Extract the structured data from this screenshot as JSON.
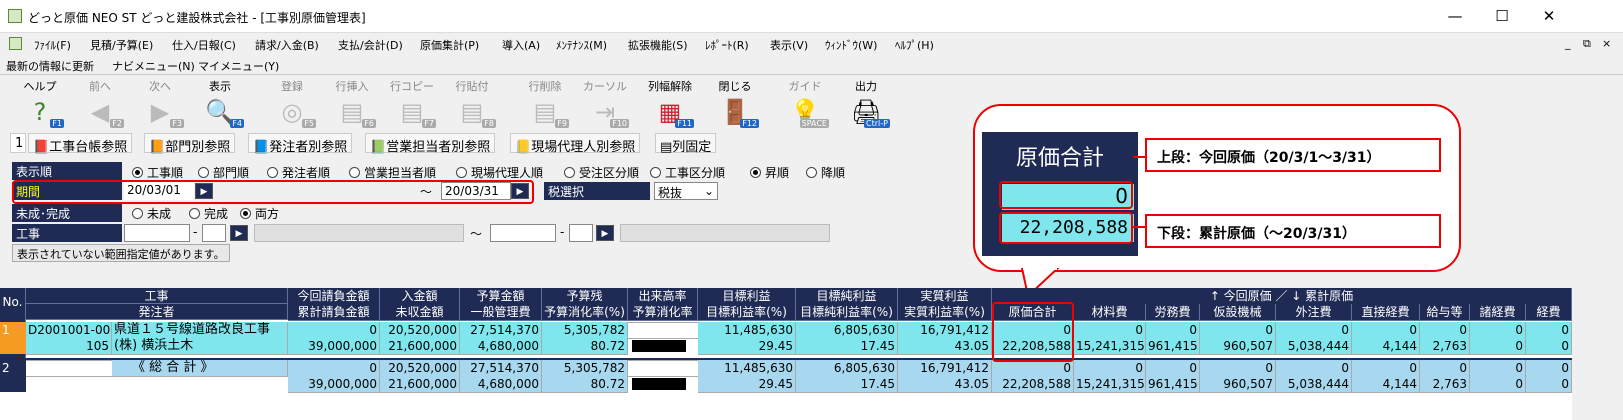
{
  "window": {
    "title": "どっと原価 NEO ST どっと建設株式会社 - [工事別原価管理表]",
    "minimize": "—",
    "maximize": "☐",
    "close": "✕"
  },
  "menu": [
    "ﾌｧｲﾙ(F)",
    "見積/予算(E)",
    "仕入/日報(C)",
    "請求/入金(B)",
    "支払/会計(D)",
    "原価集計(P)",
    "導入(A)",
    "ﾒﾝﾃﾅﾝｽ(M)",
    "拡張機能(S)",
    "ﾚﾎﾟｰﾄ(R)",
    "表示(V)",
    "ｳｨﾝﾄﾞｳ(W)",
    "ﾍﾙﾌﾟ(H)"
  ],
  "menu_right": [
    "_",
    "⧉",
    "×"
  ],
  "links": [
    "最新の情報に更新",
    "ナビメニュー(N)",
    "マイメニュー(Y)"
  ],
  "toolbar": [
    {
      "label": "ヘルプ",
      "key": "F1",
      "icon": "?"
    },
    {
      "label": "前へ",
      "key": "F2",
      "icon": "◀"
    },
    {
      "label": "次へ",
      "key": "F3",
      "icon": "▶"
    },
    {
      "label": "表示",
      "key": "F4",
      "icon": "🔍"
    },
    {
      "label": "登録",
      "key": "F5",
      "icon": "◎"
    },
    {
      "label": "行挿入",
      "key": "F6",
      "icon": "▤"
    },
    {
      "label": "行コピー",
      "key": "F7",
      "icon": "▤"
    },
    {
      "label": "行貼付",
      "key": "F8",
      "icon": "▤"
    },
    {
      "label": "行削除",
      "key": "F9",
      "icon": "▤"
    },
    {
      "label": "カーソル",
      "key": "F10",
      "icon": "⇥"
    },
    {
      "label": "列幅解除",
      "key": "F11",
      "icon": "▦"
    },
    {
      "label": "閉じる",
      "key": "F12",
      "icon": "🚪"
    },
    {
      "label": "ガイド",
      "key": "SPACE",
      "icon": "💡"
    },
    {
      "label": "出力",
      "key": "Ctrl-P",
      "icon": "🖨"
    }
  ],
  "refbar": {
    "num": "1",
    "items": [
      "工事台帳参照",
      "部門別参照",
      "発注者別参照",
      "営業担当者別参照",
      "現場代理人別参照",
      "列固定"
    ]
  },
  "form": {
    "order_label": "表示順",
    "order_opts": [
      "工事順",
      "部門順",
      "発注者順",
      "営業担当者順",
      "現場代理人順",
      "受注区分順",
      "工事区分順"
    ],
    "sort_opts": [
      "昇順",
      "降順"
    ],
    "period_label": "期間",
    "period_from": "20/03/01",
    "period_tilde": "～",
    "period_to": "20/03/31",
    "tax_label": "税選択",
    "tax_value": "税抜",
    "status_label": "未成･完成",
    "status_opts": [
      "未成",
      "完成",
      "両方"
    ],
    "koji_label": "工事",
    "dash": "-",
    "koji_tilde": "～",
    "warn": "表示されていない範囲指定値があります。"
  },
  "callout": {
    "header": "原価合計",
    "top_value": "0",
    "bottom_value": "22,208,588",
    "top_note": "上段：今回原価（20/3/1～3/31）",
    "bottom_note": "下段：累計原価（～20/3/31）"
  },
  "grid": {
    "no_label": "No.",
    "hdr_top": [
      "工事",
      "今回請負金額",
      "入金額",
      "予算金額",
      "予算残",
      "出来高率",
      "目標利益",
      "目標純利益",
      "実質利益",
      "↑ 今回原価 ／ ↓ 累計原価"
    ],
    "hdr_bot": [
      "発注者",
      "累計請負金額",
      "未収金額",
      "一般管理費",
      "予算消化率(%)",
      "予算消化率",
      "目標利益率(%)",
      "目標純利益率(%)",
      "実質利益率(%)",
      "原価合計",
      "材料費",
      "労務費",
      "仮設機械",
      "外注費",
      "直接経費",
      "給与等",
      "諸経費",
      "経費"
    ],
    "rows": [
      {
        "no": "1",
        "code": "D2001001-00",
        "name": "県道１５号線道路改良工事",
        "sub_code": "105",
        "client": "(株) 横浜土木",
        "top": [
          "0",
          "20,520,000",
          "27,514,370",
          "5,305,782",
          "",
          "11,485,630",
          "6,805,630",
          "16,791,412",
          "0",
          "0",
          "0",
          "0",
          "0",
          "0",
          "0",
          "0",
          "0"
        ],
        "bot": [
          "39,000,000",
          "21,600,000",
          "4,680,000",
          "80.72",
          "",
          "29.45",
          "17.45",
          "43.05",
          "22,208,588",
          "15,241,315",
          "961,415",
          "960,507",
          "5,038,444",
          "4,144",
          "2,763",
          "0",
          "0"
        ]
      },
      {
        "no": "2",
        "code": "",
        "name": "《 総 合 計 》",
        "sub_code": "",
        "client": "",
        "top": [
          "0",
          "20,520,000",
          "27,514,370",
          "5,305,782",
          "",
          "11,485,630",
          "6,805,630",
          "16,791,412",
          "0",
          "0",
          "0",
          "0",
          "0",
          "0",
          "0",
          "0",
          "0"
        ],
        "bot": [
          "39,000,000",
          "21,600,000",
          "4,680,000",
          "80.72",
          "",
          "29.45",
          "17.45",
          "43.05",
          "22,208,588",
          "15,241,315",
          "961,415",
          "960,507",
          "5,038,444",
          "4,144",
          "2,763",
          "0",
          "0"
        ]
      }
    ]
  }
}
